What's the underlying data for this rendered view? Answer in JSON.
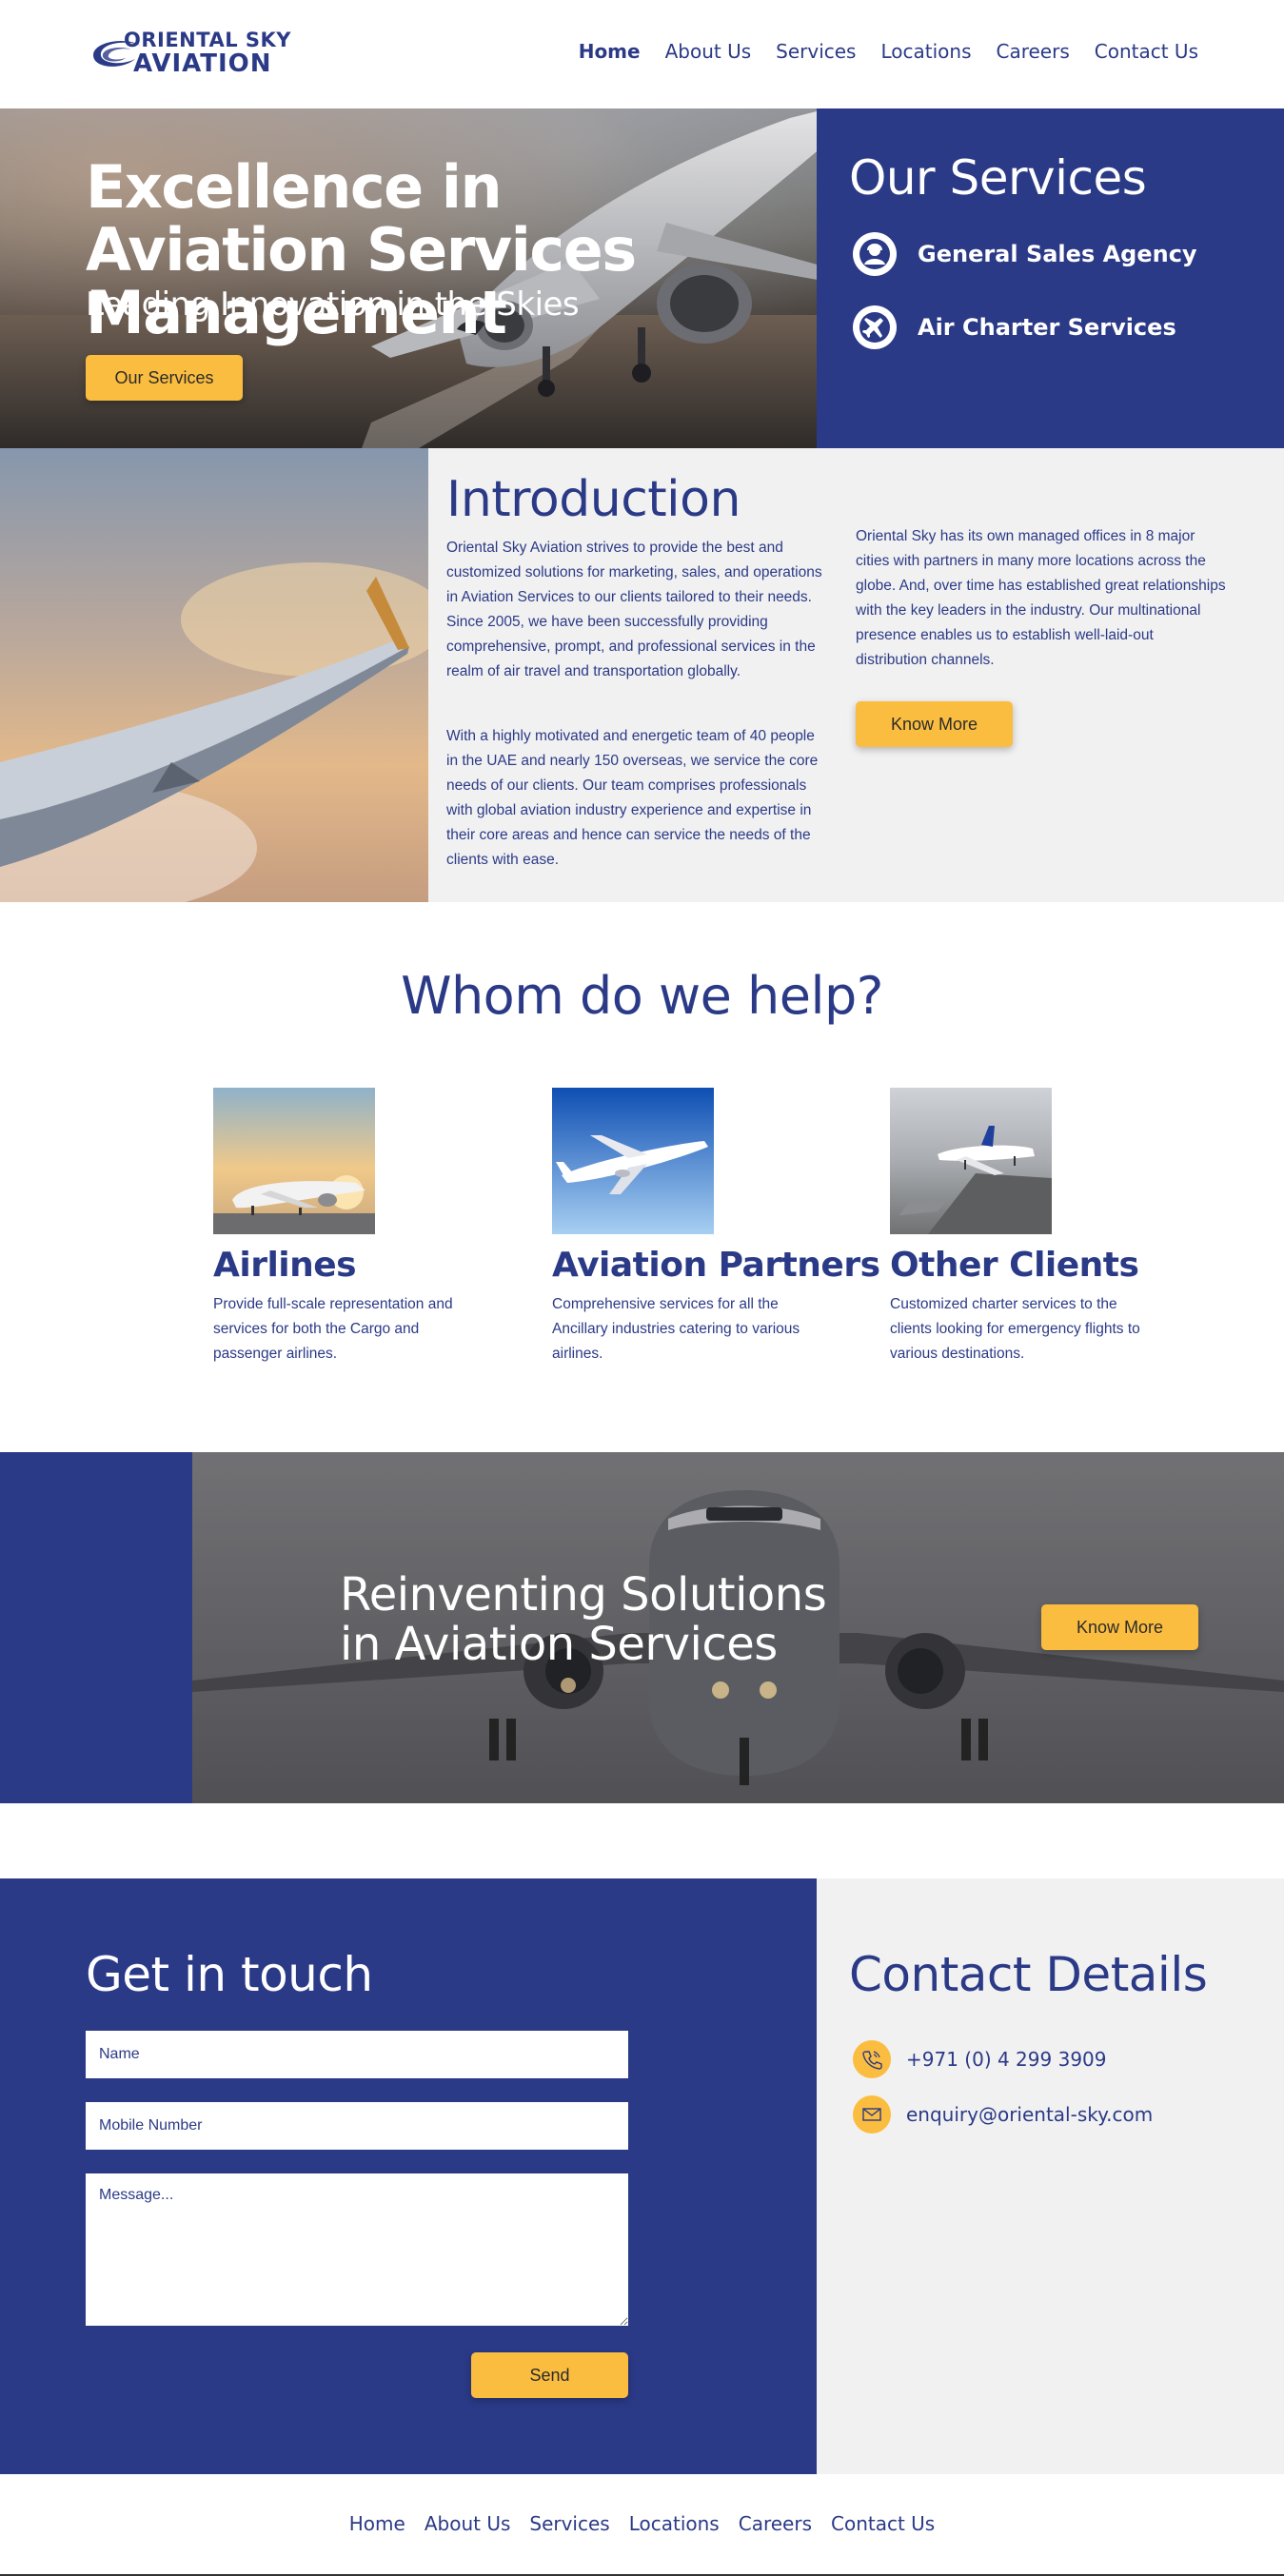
{
  "header": {
    "logo_line1": "ORIENTAL SKY",
    "logo_line2": "AVIATION",
    "nav": [
      "Home",
      "About Us",
      "Services",
      "Locations",
      "Careers",
      "Contact Us"
    ]
  },
  "hero": {
    "title": "Excellence in Aviation Services Management",
    "subtitle": "Leading Innovation in the Skies",
    "button": "Our Services"
  },
  "services_panel": {
    "title": "Our Services",
    "items": [
      {
        "label": "General Sales Agency",
        "icon": "agent-icon"
      },
      {
        "label": "Air Charter Services",
        "icon": "airplane-icon"
      }
    ]
  },
  "intro": {
    "title": "Introduction",
    "p1": "Oriental Sky Aviation strives to provide the best and customized solutions for marketing, sales, and operations in Aviation Services to our clients tailored to their needs. Since 2005, we have been successfully providing comprehensive, prompt, and professional services in the realm of air travel and transportation globally.",
    "p2": "With a highly motivated and energetic team of 40 people in the UAE and nearly 150 overseas, we service the core needs of our clients. Our team comprises professionals with global aviation industry experience and expertise in their core areas and hence can service the needs of the clients with ease.",
    "p3": "Oriental Sky has its own managed offices in 8 major cities with partners in many more locations across the globe. And, over time has established great relationships with the key leaders in the industry. Our multinational presence enables us to establish well-laid-out distribution channels.",
    "button": "Know More"
  },
  "whom": {
    "title": "Whom do we help?",
    "clients": [
      {
        "name": "Airlines",
        "desc": "Provide full-scale representation and services for both the Cargo and passenger airlines."
      },
      {
        "name": "Aviation Partners",
        "desc": "Comprehensive services for all the Ancillary industries catering to various airlines."
      },
      {
        "name": "Other Clients",
        "desc": "Customized charter services to the clients looking for emergency flights to various destinations."
      }
    ]
  },
  "banner": {
    "title": "Reinventing Solutions in Aviation Services",
    "button": "Know More"
  },
  "contact": {
    "title": "Get in touch",
    "name_placeholder": "Name",
    "mobile_placeholder": "Mobile Number",
    "message_placeholder": "Message...",
    "send": "Send"
  },
  "details": {
    "title": "Contact Details",
    "phone": "+971 (0) 4 299 3909",
    "email": "enquiry@oriental-sky.com"
  },
  "footer": {
    "nav": [
      "Home",
      "About Us",
      "Services",
      "Locations",
      "Careers",
      "Contact Us"
    ]
  },
  "colors": {
    "brand_blue": "#2b3a87",
    "accent_yellow": "#fbbd3f",
    "panel_grey": "#f1f1f1"
  }
}
